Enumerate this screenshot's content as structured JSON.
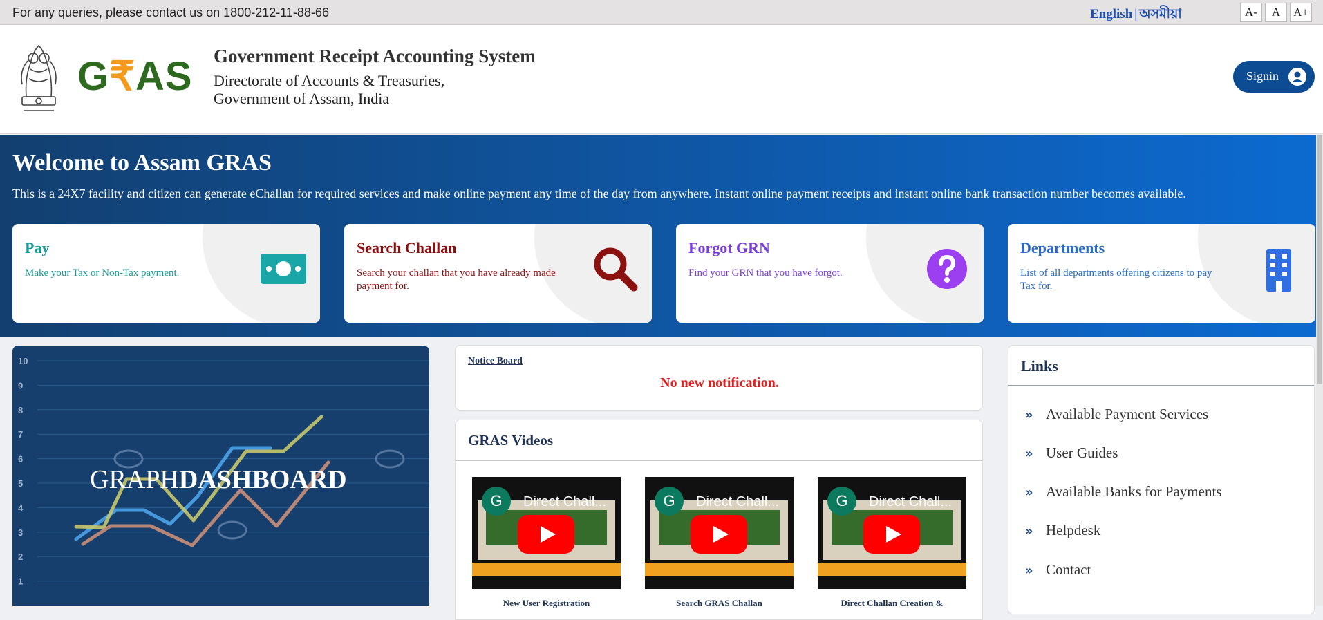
{
  "topbar": {
    "query_text": "For any queries, please contact us on 1800-212-11-88-66",
    "lang_english": "English",
    "lang_sep": "|",
    "lang_assamese": "অসমীয়া",
    "font_small": "A-",
    "font_normal": "A",
    "font_large": "A+"
  },
  "header": {
    "logo_g": "G",
    "logo_rupee": "₹",
    "logo_as": "AS",
    "title": "Government Receipt Accounting System",
    "subtitle_1": "Directorate of Accounts & Treasuries,",
    "subtitle_2": "Government of Assam, India",
    "signin_label": "Signin"
  },
  "hero": {
    "title": "Welcome to Assam GRAS",
    "description": "This is a 24X7 facility and citizen can generate eChallan for required services and make online payment any time of the day from anywhere. Instant online payment receipts and instant online bank transaction number becomes available."
  },
  "cards": [
    {
      "title": "Pay",
      "desc": "Make your Tax or Non-Tax payment.",
      "color": "#1a9a9a",
      "icon": "money-icon"
    },
    {
      "title": "Search Challan",
      "desc": "Search your challan that you have already made payment for.",
      "color": "#8b1010",
      "icon": "search-icon"
    },
    {
      "title": "Forgot GRN",
      "desc": "Find your GRN that you have forgot.",
      "color": "#7b3fd9",
      "icon": "question-icon"
    },
    {
      "title": "Departments",
      "desc": "List of all departments offering citizens to pay Tax for.",
      "color": "#2a6ac9",
      "icon": "building-icon"
    }
  ],
  "graph_banner": {
    "word_1": "GRAPH",
    "word_2": "DASHBOARD",
    "axis_ticks": [
      "10",
      "9",
      "8",
      "7",
      "6",
      "5",
      "4",
      "3",
      "2",
      "1"
    ]
  },
  "notice": {
    "title": "Notice Board",
    "message": "No new notification."
  },
  "videos": {
    "title": "GRAS Videos",
    "items": [
      {
        "thumb_title": "Direct Chall...",
        "caption": "New User Registration"
      },
      {
        "thumb_title": "Direct Chall...",
        "caption": "Search GRAS Challan"
      },
      {
        "thumb_title": "Direct Chall...",
        "caption": "Direct Challan Creation &"
      }
    ],
    "channel_initial": "G"
  },
  "links": {
    "title": "Links",
    "items": [
      "Available Payment Services",
      "User Guides",
      "Available Banks for Payments",
      "Helpdesk",
      "Contact"
    ]
  }
}
